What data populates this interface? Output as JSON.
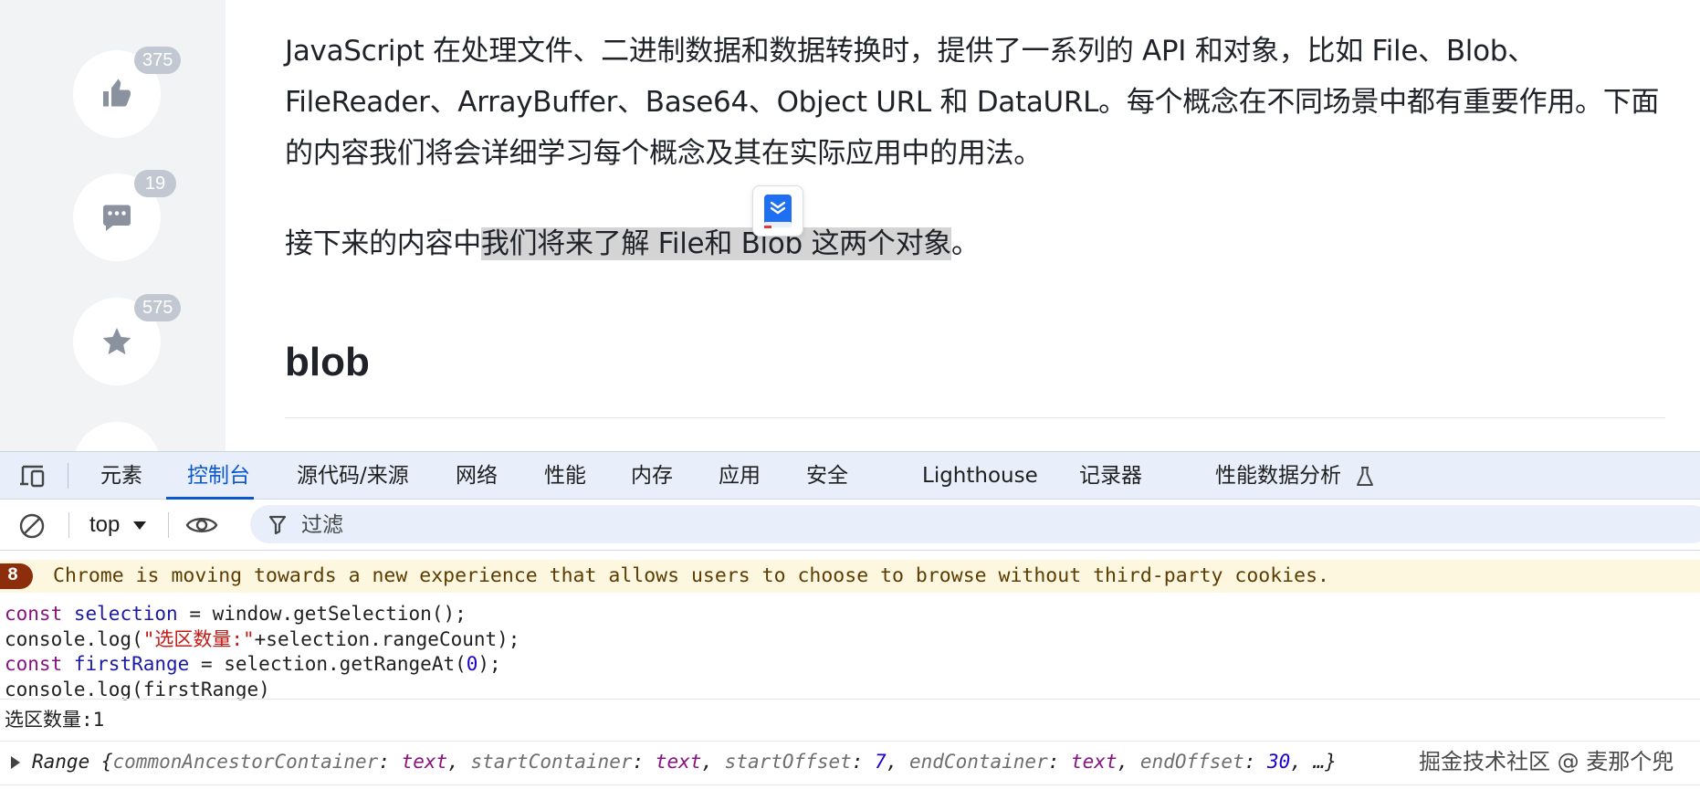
{
  "article": {
    "para1": [
      "JavaScript 在处理文件、二进制数据和数据转换时，提供了一系列的 API 和对象，比如 File、Blob、",
      "FileReader、ArrayBuffer、Base64、Object URL 和 DataURL。每个概念在不同场景中都有重要作用。下面",
      "的内容我们将会详细学习每个概念及其在实际应用中的用法。"
    ],
    "para2_before": "接下来的内容中",
    "para2_selected": "我们将来了解 File和 Blob 这两个对象",
    "para2_after": "。",
    "heading": "blob"
  },
  "actions": {
    "like_count": "375",
    "comment_count": "19",
    "star_count": "575"
  },
  "devtools": {
    "tabs": [
      "元素",
      "控制台",
      "源代码/来源",
      "网络",
      "性能",
      "内存",
      "应用",
      "安全",
      "Lighthouse",
      "记录器",
      "性能数据分析"
    ],
    "active_tab": "控制台",
    "context": "top",
    "filter_placeholder": "过滤",
    "warning_count": "8",
    "warning_text": "Chrome is moving towards a new experience that allows users to choose to browse without third-party cookies.",
    "code": {
      "l1_kw": "const",
      "l1_var": "selection",
      "l1_rest": " = window.getSelection();",
      "l2_a": "console.log(",
      "l2_str": "\"选区数量:\"",
      "l2_b": "+selection.rangeCount);",
      "l3_kw": "const",
      "l3_var": "firstRange",
      "l3_a": " = selection.getRangeAt(",
      "l3_num": "0",
      "l3_b": ");",
      "l4": "console.log(firstRange)"
    },
    "output1": "选区数量:1",
    "range": {
      "name": "Range",
      "p1": "commonAncestorContainer",
      "v1": "text",
      "p2": "startContainer",
      "v2": "text",
      "p3": "startOffset",
      "v3": "7",
      "p4": "endContainer",
      "v4": "text",
      "p5": "endOffset",
      "v5": "30",
      "ellipsis": "…"
    },
    "watermark": "掘金技术社区 @ 麦那个兜"
  }
}
